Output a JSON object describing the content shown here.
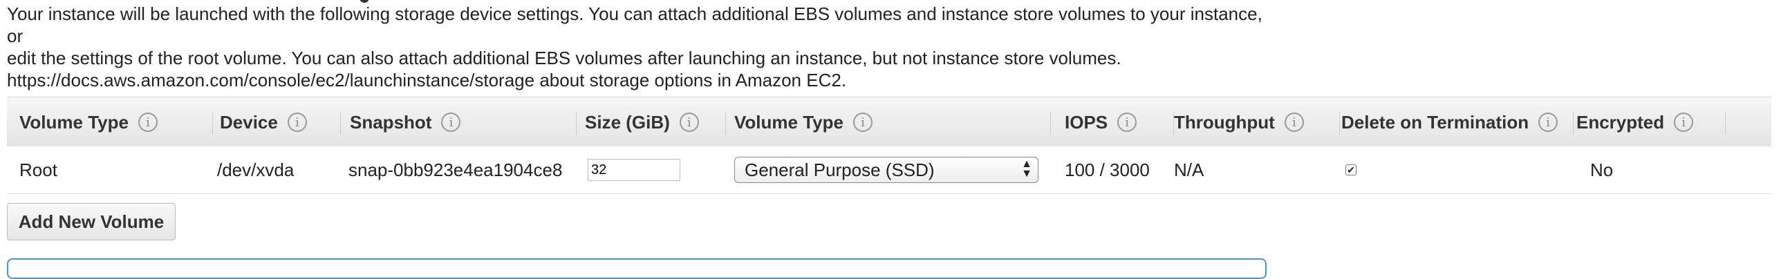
{
  "description": {
    "line1": "Your instance will be launched with the following storage device settings. You can attach additional EBS volumes and instance store volumes to your instance, or",
    "line2": "edit the settings of the root volume. You can also attach additional EBS volumes after launching an instance, but not instance store volumes.",
    "line3": "https://docs.aws.amazon.com/console/ec2/launchinstance/storage about storage options in Amazon EC2."
  },
  "table": {
    "headers": [
      "Volume Type",
      "Device",
      "Snapshot",
      "Size (GiB)",
      "Volume Type",
      "IOPS",
      "Throughput",
      "Delete on Termination",
      "Encrypted"
    ],
    "info_glyph": "i",
    "row": {
      "volume_type": "Root",
      "device": "/dev/xvda",
      "snapshot": "snap-0bb923e4ea1904ce8",
      "size": "32",
      "volume_type_select": "General Purpose (SSD)",
      "iops": "100 / 3000",
      "throughput": "N/A",
      "delete_on_termination_checked": true,
      "delete_on_termination_glyph": "✔",
      "encrypted": "No"
    }
  },
  "buttons": {
    "add_volume": "Add New Volume"
  },
  "colors": {
    "panel_border_accent": "#3d9bd1",
    "header_bg": "#ececec"
  },
  "icons": {
    "info": "info-icon",
    "select_arrows": "updown-arrows-icon",
    "checkmark": "checkmark-icon"
  }
}
